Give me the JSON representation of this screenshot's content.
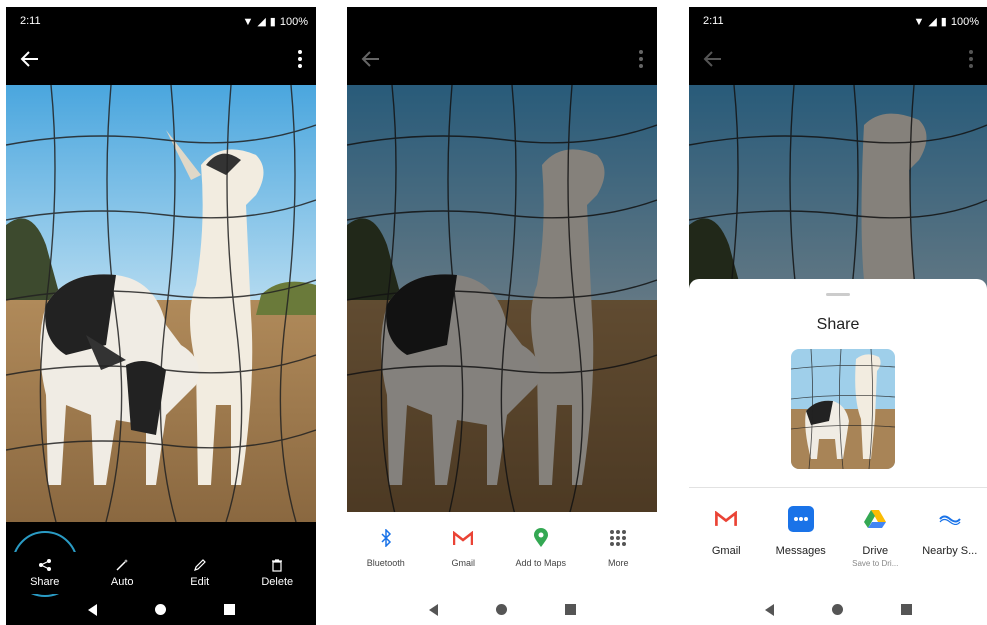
{
  "colors": {
    "accent": "#2a9bc4",
    "gmail_red": "#ea4335",
    "messages_blue": "#1a73e8",
    "maps_green": "#34a853"
  },
  "status": {
    "time": "2:11",
    "battery": "100%"
  },
  "phone1": {
    "toolbar": [
      {
        "label": "Share",
        "icon": "share-icon"
      },
      {
        "label": "Auto",
        "icon": "magic-wand-icon"
      },
      {
        "label": "Edit",
        "icon": "pencil-icon"
      },
      {
        "label": "Delete",
        "icon": "trash-icon"
      }
    ]
  },
  "phone2": {
    "share_items": [
      {
        "label": "Bluetooth",
        "icon": "bluetooth-icon"
      },
      {
        "label": "Gmail",
        "icon": "gmail-icon"
      },
      {
        "label": "Add to Maps",
        "icon": "maps-pin-icon"
      },
      {
        "label": "More",
        "icon": "grid-icon"
      }
    ]
  },
  "phone3": {
    "sheet_title": "Share",
    "targets": [
      {
        "label": "Gmail",
        "sub": "",
        "icon": "gmail-icon"
      },
      {
        "label": "Messages",
        "sub": "",
        "icon": "messages-icon"
      },
      {
        "label": "Drive",
        "sub": "Save to Dri...",
        "icon": "drive-icon"
      },
      {
        "label": "Nearby S...",
        "sub": "",
        "icon": "nearby-share-icon"
      }
    ]
  }
}
